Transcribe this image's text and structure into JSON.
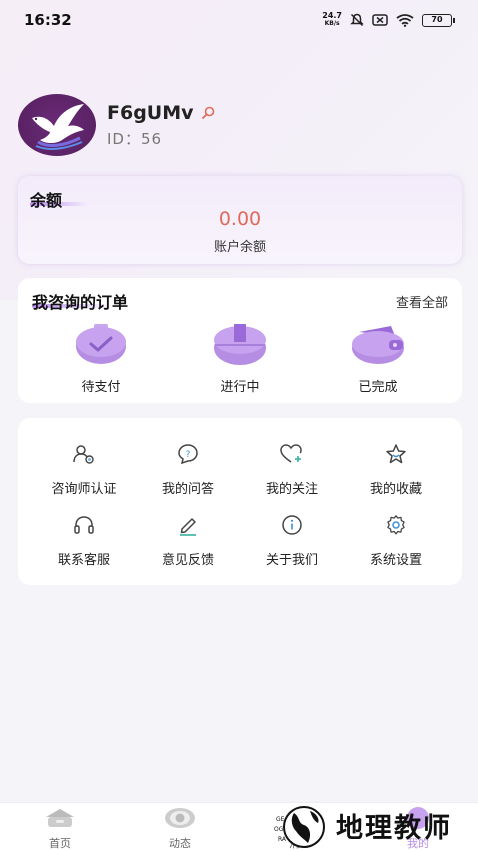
{
  "status_bar": {
    "time": "16:32",
    "net_speed_value": "24.7",
    "net_speed_unit": "KB/s",
    "battery": "70"
  },
  "profile": {
    "username": "F6gUMv",
    "user_id": "ID：56"
  },
  "balance": {
    "title": "余额",
    "amount": "0.00",
    "label": "账户余额"
  },
  "orders": {
    "title": "我咨询的订单",
    "view_all": "查看全部",
    "items": [
      {
        "label": "待支付",
        "icon": "wallet-check-icon"
      },
      {
        "label": "进行中",
        "icon": "box-icon"
      },
      {
        "label": "已完成",
        "icon": "wallet-icon"
      }
    ]
  },
  "menu": {
    "items": [
      {
        "label": "咨询师认证",
        "icon": "user-cert-icon"
      },
      {
        "label": "我的问答",
        "icon": "question-icon"
      },
      {
        "label": "我的关注",
        "icon": "heart-plus-icon"
      },
      {
        "label": "我的收藏",
        "icon": "star-icon"
      },
      {
        "label": "联系客服",
        "icon": "headset-icon"
      },
      {
        "label": "意见反馈",
        "icon": "edit-icon"
      },
      {
        "label": "关于我们",
        "icon": "info-icon"
      },
      {
        "label": "系统设置",
        "icon": "settings-icon"
      }
    ]
  },
  "bottom_nav": {
    "items": [
      {
        "label": "首页",
        "icon": "home-icon"
      },
      {
        "label": "动态",
        "icon": "eye-icon"
      },
      {
        "label": "消息",
        "icon": "message-icon"
      },
      {
        "label": "我的",
        "icon": "profile-icon"
      }
    ]
  },
  "watermark": {
    "text": "地理教师"
  },
  "colors": {
    "accent": "#b98cf0",
    "amount": "#e06a5a",
    "icon_purple": "#b58de3"
  }
}
